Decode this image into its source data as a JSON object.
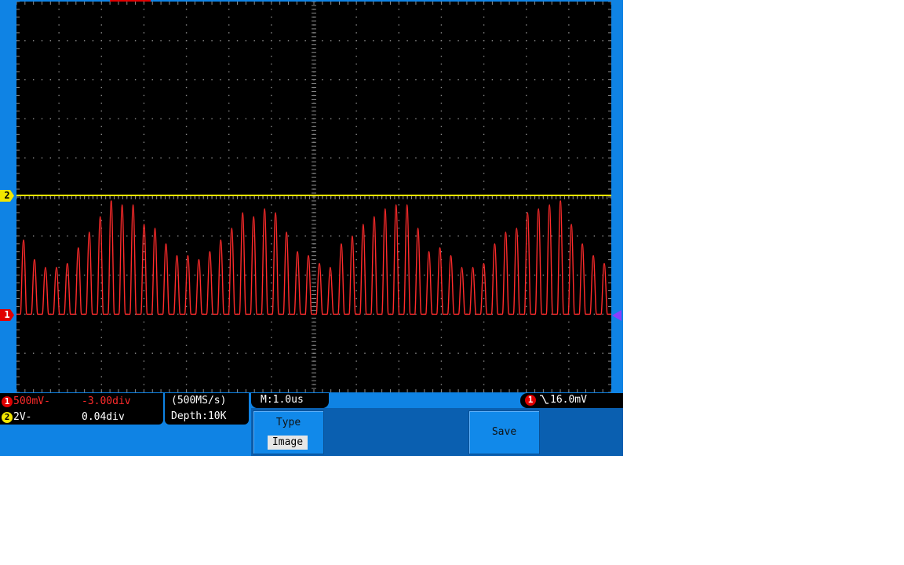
{
  "channel1": {
    "number": "1",
    "scale": "500mV-",
    "offset": "-3.00div",
    "color": "#ff2b2b"
  },
  "channel2": {
    "number": "2",
    "scale": "2V-",
    "offset": "0.04div",
    "color": "#f2e600"
  },
  "acquisition": {
    "sample_rate": "(500MS/s)",
    "depth": "Depth:10K"
  },
  "timebase": {
    "label": "M:1.0us"
  },
  "trigger": {
    "source": "1",
    "edge_icon": "falling-edge-icon",
    "level": "16.0mV"
  },
  "menu": {
    "type_label": "Type",
    "type_value": "Image",
    "save_label": "Save"
  },
  "screen": {
    "background": "#000000",
    "grid_color": "#8a8a8a",
    "frame_color": "#0f83e4",
    "h_divisions": 14,
    "v_divisions": 10
  },
  "chart_data": {
    "type": "line",
    "series": [
      {
        "name": "",
        "color": "#ff2b2b",
        "baseline_div": -3.0,
        "peaks_div": [
          1.9,
          1.4,
          1.2,
          1.2,
          1.3,
          1.7,
          2.1,
          2.5,
          2.9,
          2.8,
          2.8,
          2.3,
          2.2,
          1.8,
          1.5,
          1.5,
          1.4,
          1.6,
          1.9,
          2.2,
          2.6,
          2.5,
          2.7,
          2.6,
          2.1,
          1.6,
          1.5,
          1.3,
          1.2,
          1.8,
          2.0,
          2.3,
          2.5,
          2.7,
          2.8,
          2.8,
          2.2,
          1.6,
          1.7,
          1.5,
          1.2,
          1.2,
          1.3,
          1.8,
          2.1,
          2.2,
          2.6,
          2.7,
          2.8,
          2.9,
          2.3,
          1.8,
          1.5,
          1.3
        ],
        "x_range_div": [
          0,
          14
        ]
      },
      {
        "name": "",
        "color": "#f2e600",
        "level_div": 0.04
      }
    ],
    "x_divisions": 14,
    "y_divisions": 10,
    "grid": true
  }
}
